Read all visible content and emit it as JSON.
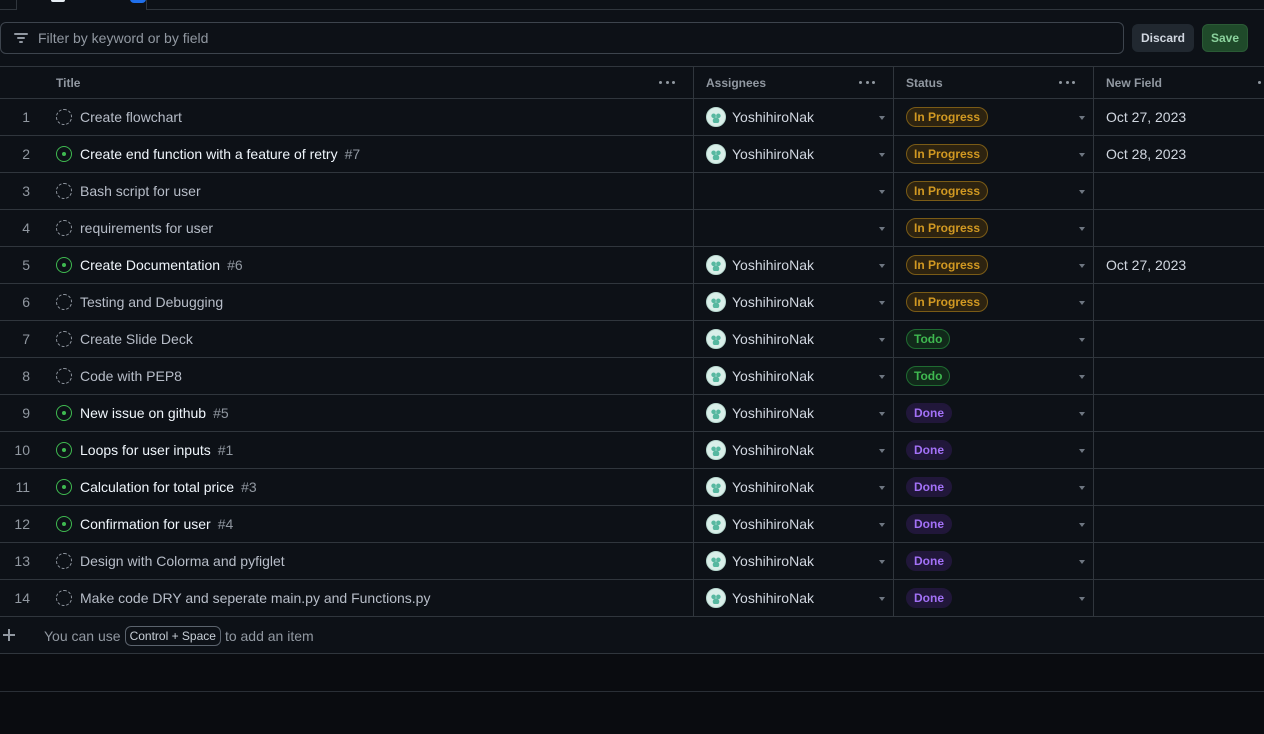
{
  "filter": {
    "placeholder": "Filter by keyword or by field",
    "discard_label": "Discard",
    "save_label": "Save"
  },
  "columns": {
    "title": "Title",
    "assignees": "Assignees",
    "status": "Status",
    "new_field": "New Field"
  },
  "rows": [
    {
      "num": "1",
      "title": "Create flowchart",
      "issue": "",
      "type": "draft",
      "assignee": "YoshihiroNak",
      "status": "In Progress",
      "status_kind": "inprogress",
      "date": "Oct 27, 2023"
    },
    {
      "num": "2",
      "title": "Create end function with a feature of retry",
      "issue": "#7",
      "type": "open",
      "assignee": "YoshihiroNak",
      "status": "In Progress",
      "status_kind": "inprogress",
      "date": "Oct 28, 2023"
    },
    {
      "num": "3",
      "title": "Bash script for user",
      "issue": "",
      "type": "draft",
      "assignee": "",
      "status": "In Progress",
      "status_kind": "inprogress",
      "date": ""
    },
    {
      "num": "4",
      "title": "requirements for user",
      "issue": "",
      "type": "draft",
      "assignee": "",
      "status": "In Progress",
      "status_kind": "inprogress",
      "date": ""
    },
    {
      "num": "5",
      "title": "Create Documentation",
      "issue": "#6",
      "type": "open",
      "assignee": "YoshihiroNak",
      "status": "In Progress",
      "status_kind": "inprogress",
      "date": "Oct 27, 2023"
    },
    {
      "num": "6",
      "title": "Testing and Debugging",
      "issue": "",
      "type": "draft",
      "assignee": "YoshihiroNak",
      "status": "In Progress",
      "status_kind": "inprogress",
      "date": ""
    },
    {
      "num": "7",
      "title": "Create Slide Deck",
      "issue": "",
      "type": "draft",
      "assignee": "YoshihiroNak",
      "status": "Todo",
      "status_kind": "todo",
      "date": ""
    },
    {
      "num": "8",
      "title": "Code with PEP8",
      "issue": "",
      "type": "draft",
      "assignee": "YoshihiroNak",
      "status": "Todo",
      "status_kind": "todo",
      "date": ""
    },
    {
      "num": "9",
      "title": "New issue on github",
      "issue": "#5",
      "type": "open",
      "assignee": "YoshihiroNak",
      "status": "Done",
      "status_kind": "done",
      "date": ""
    },
    {
      "num": "10",
      "title": "Loops for user inputs",
      "issue": "#1",
      "type": "open",
      "assignee": "YoshihiroNak",
      "status": "Done",
      "status_kind": "done",
      "date": ""
    },
    {
      "num": "11",
      "title": "Calculation for total price",
      "issue": "#3",
      "type": "open",
      "assignee": "YoshihiroNak",
      "status": "Done",
      "status_kind": "done",
      "date": ""
    },
    {
      "num": "12",
      "title": "Confirmation for user",
      "issue": "#4",
      "type": "open",
      "assignee": "YoshihiroNak",
      "status": "Done",
      "status_kind": "done",
      "date": ""
    },
    {
      "num": "13",
      "title": "Design with Colorma and pyfiglet",
      "issue": "",
      "type": "draft",
      "assignee": "YoshihiroNak",
      "status": "Done",
      "status_kind": "done",
      "date": ""
    },
    {
      "num": "14",
      "title": "Make code DRY and seperate main.py and Functions.py",
      "issue": "",
      "type": "draft",
      "assignee": "YoshihiroNak",
      "status": "Done",
      "status_kind": "done",
      "date": ""
    }
  ],
  "add_item": {
    "prefix": "You can use",
    "shortcut": "Control + Space",
    "suffix": "to add an item"
  },
  "icons": {
    "filter": "filter-icon",
    "draft": "draft-issue-icon",
    "open": "open-issue-icon",
    "add": "plus-icon",
    "column_menu": "kebab-icon",
    "dropdown": "caret-down-icon"
  },
  "colors": {
    "background": "#0d1117",
    "in_progress": "#d29922",
    "todo": "#3fb950",
    "done": "#a371f7",
    "save": "#1f4a2a"
  }
}
